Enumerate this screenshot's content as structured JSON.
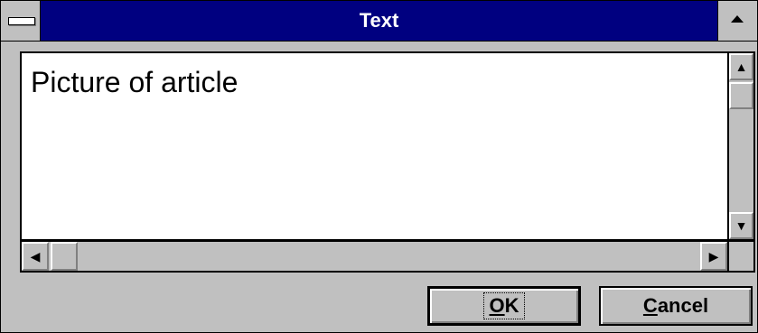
{
  "window": {
    "title": "Text"
  },
  "editor": {
    "content": "Picture of article"
  },
  "buttons": {
    "ok": {
      "mnemonic": "O",
      "rest": "K"
    },
    "cancel": {
      "mnemonic": "C",
      "rest": "ancel"
    }
  },
  "icons": {
    "system_menu": "system-menu-icon",
    "maximize": "maximize-icon",
    "scroll_up": "arrow-up-icon",
    "scroll_down": "arrow-down-icon",
    "scroll_left": "arrow-left-icon",
    "scroll_right": "arrow-right-icon"
  },
  "colors": {
    "titlebar": "#000080",
    "face": "#c0c0c0",
    "title_text": "#ffffff"
  }
}
